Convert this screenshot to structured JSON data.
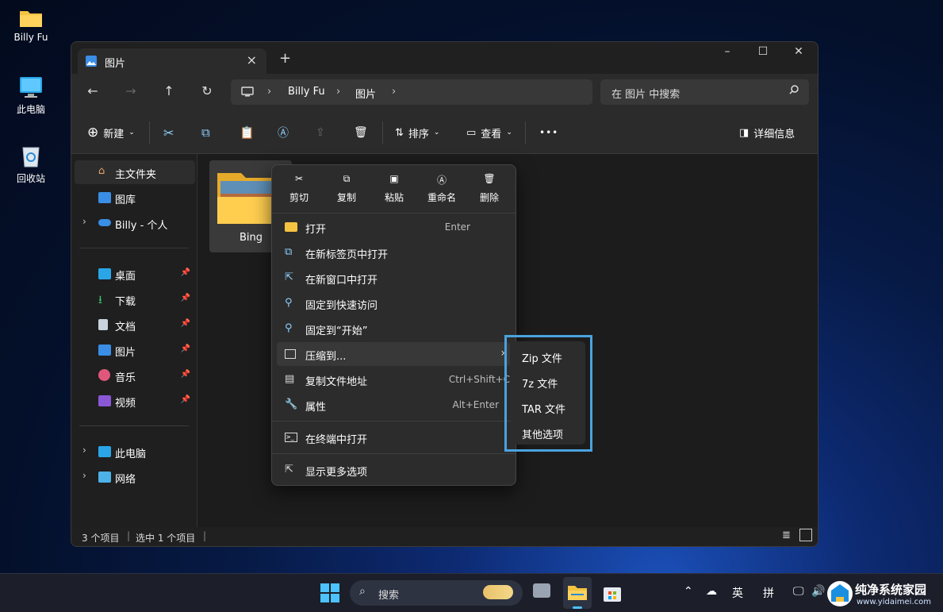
{
  "desktop": {
    "icons": [
      {
        "label": "Billy Fu",
        "icon": "folder-icon"
      },
      {
        "label": "此电脑",
        "icon": "monitor-icon"
      },
      {
        "label": "回收站",
        "icon": "recycle-bin-icon"
      }
    ]
  },
  "window": {
    "tab_title": "图片",
    "address": {
      "segments": [
        "Billy Fu",
        "图片"
      ]
    },
    "search_placeholder": "在 图片 中搜索",
    "toolbar": {
      "new_label": "新建",
      "sort_label": "排序",
      "view_label": "查看",
      "more_label": "•••",
      "details_label": "详细信息"
    },
    "sidebar": {
      "items": [
        {
          "label": "主文件夹",
          "icon": "home-icon"
        },
        {
          "label": "图库",
          "icon": "gallery-icon"
        },
        {
          "label": "Billy - 个人",
          "icon": "onedrive-icon"
        },
        {
          "label": "桌面",
          "icon": "desktop-icon"
        },
        {
          "label": "下载",
          "icon": "download-icon"
        },
        {
          "label": "文档",
          "icon": "document-icon"
        },
        {
          "label": "图片",
          "icon": "pictures-icon"
        },
        {
          "label": "音乐",
          "icon": "music-icon"
        },
        {
          "label": "视频",
          "icon": "video-icon"
        },
        {
          "label": "此电脑",
          "icon": "pc-icon"
        },
        {
          "label": "网络",
          "icon": "network-icon"
        }
      ]
    },
    "content": {
      "folder_name": "Bing"
    },
    "status": {
      "items_count": "3 个项目",
      "selected": "选中 1 个项目"
    }
  },
  "context_menu": {
    "quick_actions": [
      {
        "label": "剪切",
        "icon": "cut-icon"
      },
      {
        "label": "复制",
        "icon": "copy-icon"
      },
      {
        "label": "粘贴",
        "icon": "paste-icon"
      },
      {
        "label": "重命名",
        "icon": "rename-icon"
      },
      {
        "label": "删除",
        "icon": "delete-icon"
      }
    ],
    "items": [
      {
        "label": "打开",
        "shortcut": "Enter",
        "icon": "folder-open-icon"
      },
      {
        "label": "在新标签页中打开",
        "shortcut": "",
        "icon": "new-tab-icon"
      },
      {
        "label": "在新窗口中打开",
        "shortcut": "",
        "icon": "new-window-icon"
      },
      {
        "label": "固定到快速访问",
        "shortcut": "",
        "icon": "pin-icon"
      },
      {
        "label": "固定到“开始”",
        "shortcut": "",
        "icon": "pin-start-icon"
      },
      {
        "label": "压缩到...",
        "shortcut": "",
        "icon": "zip-icon"
      },
      {
        "label": "复制文件地址",
        "shortcut": "Ctrl+Shift+C",
        "icon": "copy-path-icon"
      },
      {
        "label": "属性",
        "shortcut": "Alt+Enter",
        "icon": "wrench-icon"
      },
      {
        "label": "在终端中打开",
        "shortcut": "",
        "icon": "terminal-icon"
      },
      {
        "label": "显示更多选项",
        "shortcut": "",
        "icon": "more-options-icon"
      }
    ],
    "submenu": [
      "Zip 文件",
      "7z 文件",
      "TAR 文件",
      "其他选项"
    ]
  },
  "taskbar": {
    "search_label": "搜索",
    "ime_lang": "英",
    "ime_mode": "拼"
  },
  "watermark": {
    "title": "纯净系统家园",
    "url": "www.yidaimei.com"
  }
}
